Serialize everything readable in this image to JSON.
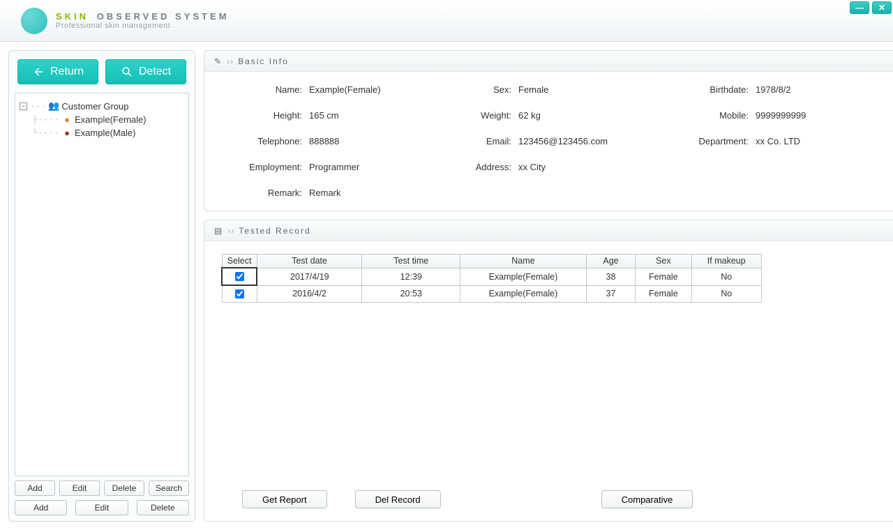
{
  "app": {
    "brand_p1": "SKIN",
    "brand_p2": "OBSERVED SYSTEM",
    "brand_sub": "Professional skin management"
  },
  "winctl": {
    "minimize": "—",
    "close": "✕"
  },
  "sidebar": {
    "return_label": "Return",
    "detect_label": "Detect",
    "tree": {
      "root": "Customer Group",
      "items": [
        "Example(Female)",
        "Example(Male)"
      ]
    },
    "row1": {
      "add": "Add",
      "edit": "Edit",
      "delete": "Delete",
      "search": "Search"
    },
    "row2": {
      "add": "Add",
      "edit": "Edit",
      "delete": "Delete"
    }
  },
  "basic": {
    "title": "Basic Info",
    "labels": {
      "name": "Name:",
      "sex": "Sex:",
      "birthdate": "Birthdate:",
      "height": "Height:",
      "weight": "Weight:",
      "mobile": "Mobile:",
      "telephone": "Telephone:",
      "email": "Email:",
      "department": "Department:",
      "employment": "Employment:",
      "address": "Address:",
      "remark": "Remark:"
    },
    "values": {
      "name": "Example(Female)",
      "sex": "Female",
      "birthdate": "1978/8/2",
      "height": "165 cm",
      "weight": "62 kg",
      "mobile": "9999999999",
      "telephone": "888888",
      "email": "123456@123456.com",
      "department": "xx  Co. LTD",
      "employment": "Programmer",
      "address": "xx City",
      "remark": "Remark"
    }
  },
  "records": {
    "title": "Tested Record",
    "headers": {
      "select": "Select",
      "date": "Test date",
      "time": "Test time",
      "name": "Name",
      "age": "Age",
      "sex": "Sex",
      "makeup": "If makeup"
    },
    "rows": [
      {
        "selected": true,
        "date": "2017/4/19",
        "time": "12:39",
        "name": "Example(Female)",
        "age": "38",
        "sex": "Female",
        "makeup": "No"
      },
      {
        "selected": true,
        "date": "2016/4/2",
        "time": "20:53",
        "name": "Example(Female)",
        "age": "37",
        "sex": "Female",
        "makeup": "No"
      }
    ],
    "buttons": {
      "get_report": "Get Report",
      "del_record": "Del Record",
      "comparative": "Comparative"
    }
  }
}
